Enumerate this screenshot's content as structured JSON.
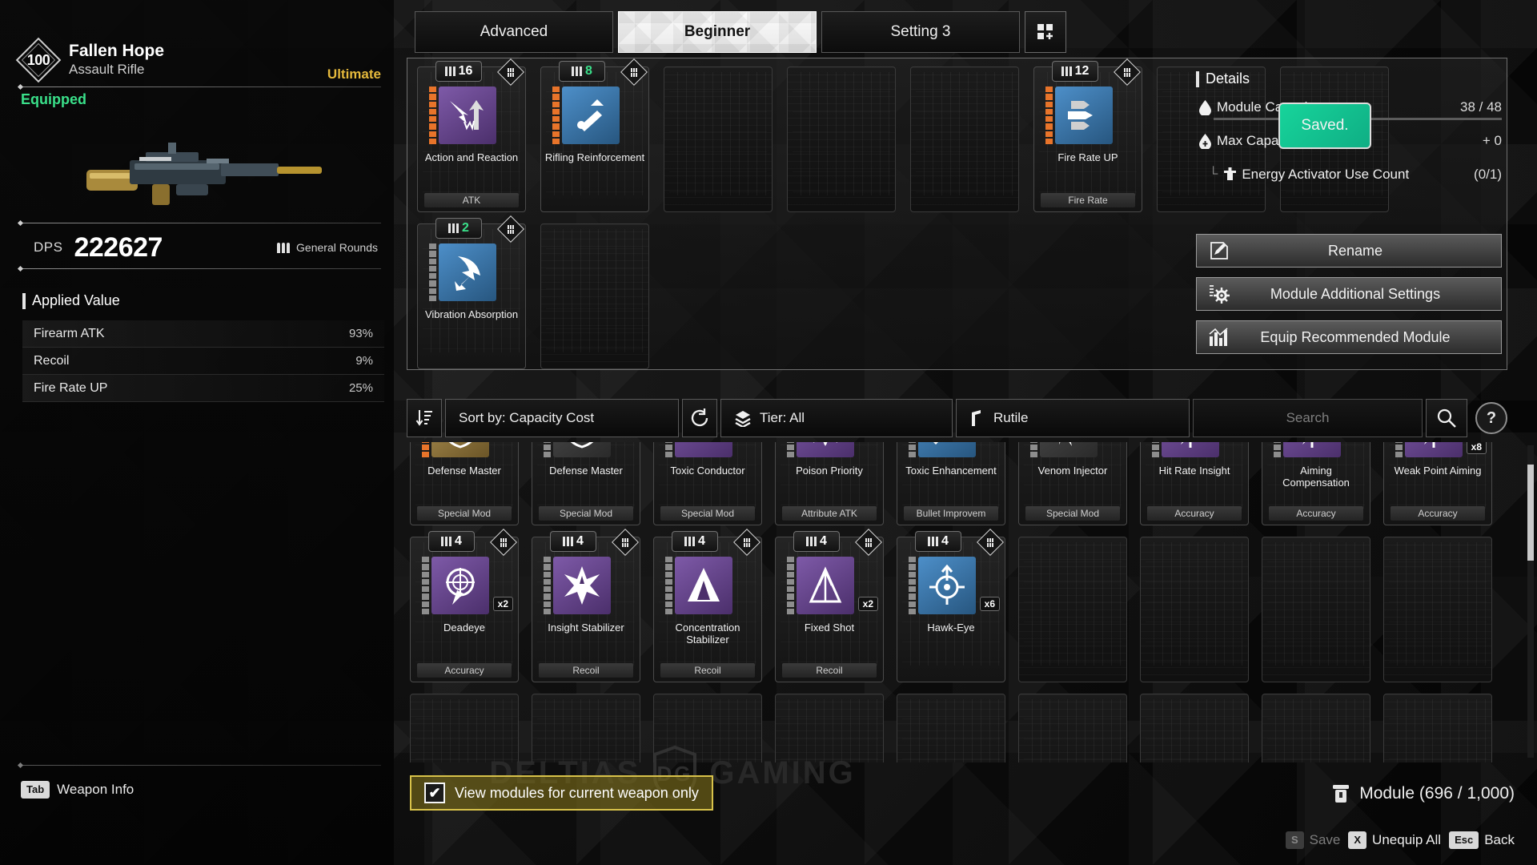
{
  "weapon": {
    "level": "100",
    "name": "Fallen Hope",
    "type": "Assault Rifle",
    "rarity": "Ultimate",
    "status": "Equipped",
    "dps_label": "DPS",
    "dps_value": "222627",
    "ammo_type": "General Rounds",
    "applied_value_title": "Applied Value",
    "stats": [
      {
        "name": "Firearm ATK",
        "value": "93%"
      },
      {
        "name": "Recoil",
        "value": "9%"
      },
      {
        "name": "Fire Rate UP",
        "value": "25%"
      }
    ],
    "weapon_info_key": "Tab",
    "weapon_info_label": "Weapon Info"
  },
  "tabs": {
    "items": [
      {
        "label": "Advanced",
        "active": false
      },
      {
        "label": "Beginner",
        "active": true
      },
      {
        "label": "Setting 3",
        "active": false
      }
    ],
    "add_label": "+"
  },
  "equipped_slots": [
    {
      "name": "Action and Reaction",
      "cost": "16",
      "cost_color": "white",
      "category": "ATK",
      "icon": "impact-arrow-icon",
      "icon_color": "purple",
      "energy": "orange",
      "empty": false
    },
    {
      "name": "Rifling Reinforcement",
      "cost": "8",
      "cost_color": "green",
      "category": "",
      "icon": "barrel-up-icon",
      "icon_color": "blue",
      "energy": "orange",
      "empty": false
    },
    {
      "name": "",
      "cost": "",
      "category": "",
      "icon": "",
      "empty": true
    },
    {
      "name": "",
      "cost": "",
      "category": "",
      "icon": "",
      "empty": true
    },
    {
      "name": "",
      "cost": "",
      "category": "",
      "icon": "",
      "empty": true
    },
    {
      "name": "Fire Rate UP",
      "cost": "12",
      "cost_color": "white",
      "category": "Fire Rate",
      "icon": "bullets-icon",
      "icon_color": "blue",
      "energy": "orange",
      "empty": false
    },
    {
      "name": "",
      "cost": "",
      "category": "",
      "icon": "",
      "empty": true
    },
    {
      "name": "",
      "cost": "",
      "category": "",
      "icon": "",
      "empty": true
    },
    {
      "name": "Vibration Absorption",
      "cost": "2",
      "cost_color": "green",
      "category": "",
      "icon": "recoil-arrow-icon",
      "icon_color": "blue",
      "energy": "grey",
      "empty": false
    },
    {
      "name": "",
      "cost": "",
      "category": "",
      "icon": "",
      "empty": true
    }
  ],
  "details": {
    "title": "Details",
    "module_capacity_label": "Module Capacity",
    "module_capacity_value": "38 / 48",
    "max_capacity_label": "Max Capacity UP",
    "max_capacity_value": "+ 0",
    "energy_activator_label": "Energy Activator Use Count",
    "energy_activator_value": "(0/1)",
    "saved_toast": "Saved.",
    "buttons": [
      {
        "label": "Rename",
        "icon": "pencil-icon"
      },
      {
        "label": "Module Additional Settings",
        "icon": "gear-icon"
      },
      {
        "label": "Equip Recommended Module",
        "icon": "chart-icon"
      }
    ]
  },
  "filter_bar": {
    "sort_icon": "sort-descending-icon",
    "sort_label": "Sort by: Capacity Cost",
    "reset_icon": "reset-icon",
    "tier_icon": "layers-icon",
    "tier_label": "Tier: All",
    "rutile_icon": "rutile-icon",
    "rutile_label": "Rutile",
    "search_placeholder": "Search",
    "search_value": "",
    "search_icon": "search-icon",
    "help_label": "?"
  },
  "inventory": [
    {
      "name": "Defense Master",
      "category": "Special Mod",
      "cost": "",
      "icon": "shield-crest-icon",
      "icon_color": "gold",
      "energy": "multi",
      "qty": "",
      "empty": false,
      "clipped_top": true
    },
    {
      "name": "Defense Master",
      "category": "Special Mod",
      "cost": "",
      "icon": "shield-crest-icon",
      "icon_color": "grey",
      "energy": "grey",
      "qty": "",
      "empty": false,
      "clipped_top": true
    },
    {
      "name": "Toxic Conductor",
      "category": "Special Mod",
      "cost": "",
      "icon": "toxic-skull-icon",
      "icon_color": "purple",
      "energy": "grey",
      "qty": "",
      "empty": false,
      "clipped_top": true
    },
    {
      "name": "Poison Priority",
      "category": "Attribute ATK",
      "cost": "",
      "icon": "poison-burst-icon",
      "icon_color": "purple",
      "energy": "grey",
      "qty": "",
      "empty": false,
      "clipped_top": true
    },
    {
      "name": "Toxic Enhancement",
      "category": "Bullet Improvem",
      "cost": "",
      "icon": "toxic-blade-icon",
      "icon_color": "blue",
      "energy": "grey",
      "qty": "",
      "empty": false,
      "clipped_top": true
    },
    {
      "name": "Venom Injector",
      "category": "Special Mod",
      "cost": "",
      "icon": "venom-icon",
      "icon_color": "grey",
      "energy": "grey",
      "qty": "",
      "empty": false,
      "clipped_top": true
    },
    {
      "name": "Hit Rate Insight",
      "category": "Accuracy",
      "cost": "",
      "icon": "crosshair-icon",
      "icon_color": "purple",
      "energy": "grey",
      "qty": "",
      "empty": false,
      "clipped_top": true
    },
    {
      "name": "Aiming Compensation",
      "category": "Accuracy",
      "cost": "",
      "icon": "crosshair-icon",
      "icon_color": "purple",
      "energy": "grey",
      "qty": "",
      "empty": false,
      "clipped_top": true
    },
    {
      "name": "Weak Point Aiming",
      "category": "Accuracy",
      "cost": "",
      "icon": "crosshair-icon",
      "icon_color": "purple",
      "energy": "grey",
      "qty": "x8",
      "empty": false,
      "clipped_top": true
    },
    {
      "name": "Deadeye",
      "category": "Accuracy",
      "cost": "4",
      "cost_color": "white",
      "icon": "scope-icon",
      "icon_color": "purple",
      "energy": "grey",
      "qty": "x2",
      "empty": false
    },
    {
      "name": "Insight Stabilizer",
      "category": "Recoil",
      "cost": "4",
      "cost_color": "white",
      "icon": "burst-star-icon",
      "icon_color": "purple",
      "energy": "grey",
      "qty": "",
      "empty": false
    },
    {
      "name": "Concentration Stabilizer",
      "category": "Recoil",
      "cost": "4",
      "cost_color": "white",
      "icon": "tri-arrow-icon",
      "icon_color": "purple",
      "energy": "grey",
      "qty": "",
      "empty": false
    },
    {
      "name": "Fixed Shot",
      "category": "Recoil",
      "cost": "4",
      "cost_color": "white",
      "icon": "spread-icon",
      "icon_color": "purple",
      "energy": "grey",
      "qty": "x2",
      "empty": false
    },
    {
      "name": "Hawk-Eye",
      "category": "",
      "cost": "4",
      "cost_color": "white",
      "icon": "target-up-icon",
      "icon_color": "blue",
      "energy": "grey",
      "qty": "x6",
      "empty": false
    },
    {
      "name": "",
      "category": "",
      "cost": "",
      "icon": "",
      "qty": "",
      "empty": true
    },
    {
      "name": "",
      "category": "",
      "cost": "",
      "icon": "",
      "qty": "",
      "empty": true
    },
    {
      "name": "",
      "category": "",
      "cost": "",
      "icon": "",
      "qty": "",
      "empty": true
    },
    {
      "name": "",
      "category": "",
      "cost": "",
      "icon": "",
      "qty": "",
      "empty": true
    },
    {
      "name": "",
      "category": "",
      "cost": "",
      "icon": "",
      "qty": "",
      "empty": true
    },
    {
      "name": "",
      "category": "",
      "cost": "",
      "icon": "",
      "qty": "",
      "empty": true
    },
    {
      "name": "",
      "category": "",
      "cost": "",
      "icon": "",
      "qty": "",
      "empty": true
    },
    {
      "name": "",
      "category": "",
      "cost": "",
      "icon": "",
      "qty": "",
      "empty": true
    },
    {
      "name": "",
      "category": "",
      "cost": "",
      "icon": "",
      "qty": "",
      "empty": true
    },
    {
      "name": "",
      "category": "",
      "cost": "",
      "icon": "",
      "qty": "",
      "empty": true
    },
    {
      "name": "",
      "category": "",
      "cost": "",
      "icon": "",
      "qty": "",
      "empty": true
    },
    {
      "name": "",
      "category": "",
      "cost": "",
      "icon": "",
      "qty": "",
      "empty": true
    },
    {
      "name": "",
      "category": "",
      "cost": "",
      "icon": "",
      "qty": "",
      "empty": true
    }
  ],
  "bottom": {
    "checkbox_checked": true,
    "checkbox_label": "View modules for current weapon only",
    "module_count_label": "Module (696 / 1,000)",
    "module_count_icon": "capsule-icon",
    "keys": [
      {
        "key": "S",
        "label": "Save",
        "dim": true
      },
      {
        "key": "X",
        "label": "Unequip All",
        "dim": false
      },
      {
        "key": "Esc",
        "label": "Back",
        "dim": false
      }
    ]
  },
  "watermark": {
    "left": "DELTIAS",
    "right": "GAMING",
    "logo": "DG"
  },
  "colors": {
    "accent_green": "#3ae08a",
    "rarity_gold": "#e5b93c",
    "checkbox_yellow": "#d8c24a",
    "energy_orange": "#e8742a"
  }
}
